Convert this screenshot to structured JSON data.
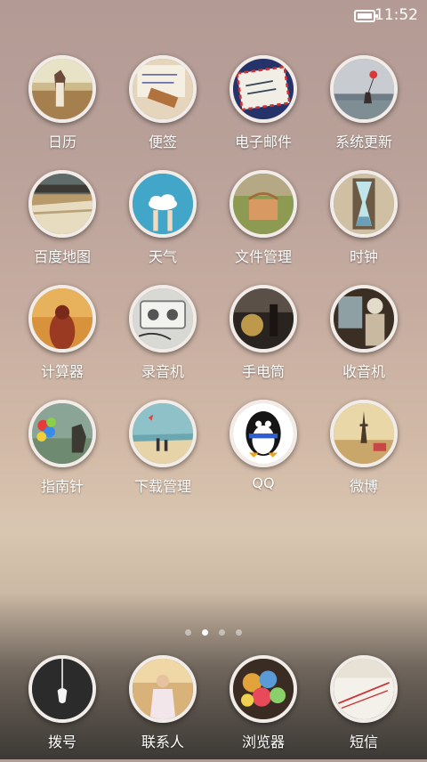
{
  "status": {
    "time": "11:52",
    "battery_icon": "battery-icon"
  },
  "apps": [
    {
      "label": "日历"
    },
    {
      "label": "便签"
    },
    {
      "label": "电子邮件"
    },
    {
      "label": "系统更新"
    },
    {
      "label": "百度地图"
    },
    {
      "label": "天气"
    },
    {
      "label": "文件管理"
    },
    {
      "label": "时钟"
    },
    {
      "label": "计算器"
    },
    {
      "label": "录音机"
    },
    {
      "label": "手电筒"
    },
    {
      "label": "收音机"
    },
    {
      "label": "指南针"
    },
    {
      "label": "下载管理"
    },
    {
      "label": "QQ"
    },
    {
      "label": "微博"
    }
  ],
  "pager": {
    "pages": 4,
    "current": 2
  },
  "dock": [
    {
      "label": "拨号"
    },
    {
      "label": "联系人"
    },
    {
      "label": "浏览器"
    },
    {
      "label": "短信"
    }
  ]
}
